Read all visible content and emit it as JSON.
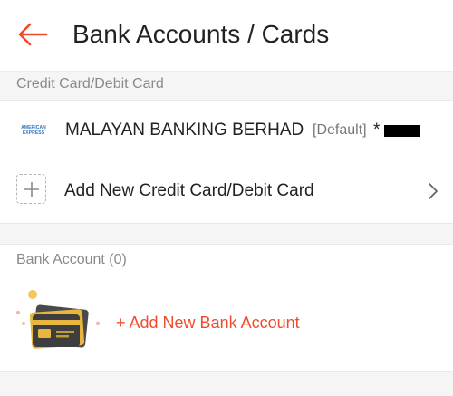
{
  "header": {
    "back_icon": "arrow-left-icon",
    "title": "Bank Accounts / Cards",
    "accent_color": "#ee4d2d"
  },
  "credit_section": {
    "label": "Credit Card/Debit Card",
    "cards": [
      {
        "brand_icon": "amex-logo-icon",
        "brand_text_top": "AMERICAN",
        "brand_text_bottom": "EXPRESS",
        "bank_name": "MALAYAN BANKING BERHAD",
        "tag": "[Default]",
        "masked_prefix": "*"
      }
    ],
    "add_label": "Add New Credit Card/Debit Card",
    "add_icon": "plus-icon",
    "chevron_icon": "chevron-right-icon"
  },
  "bank_section": {
    "label": "Bank Account (0)",
    "add_label": "+ Add New Bank Account",
    "illustration_icon": "bank-card-illustration-icon"
  }
}
